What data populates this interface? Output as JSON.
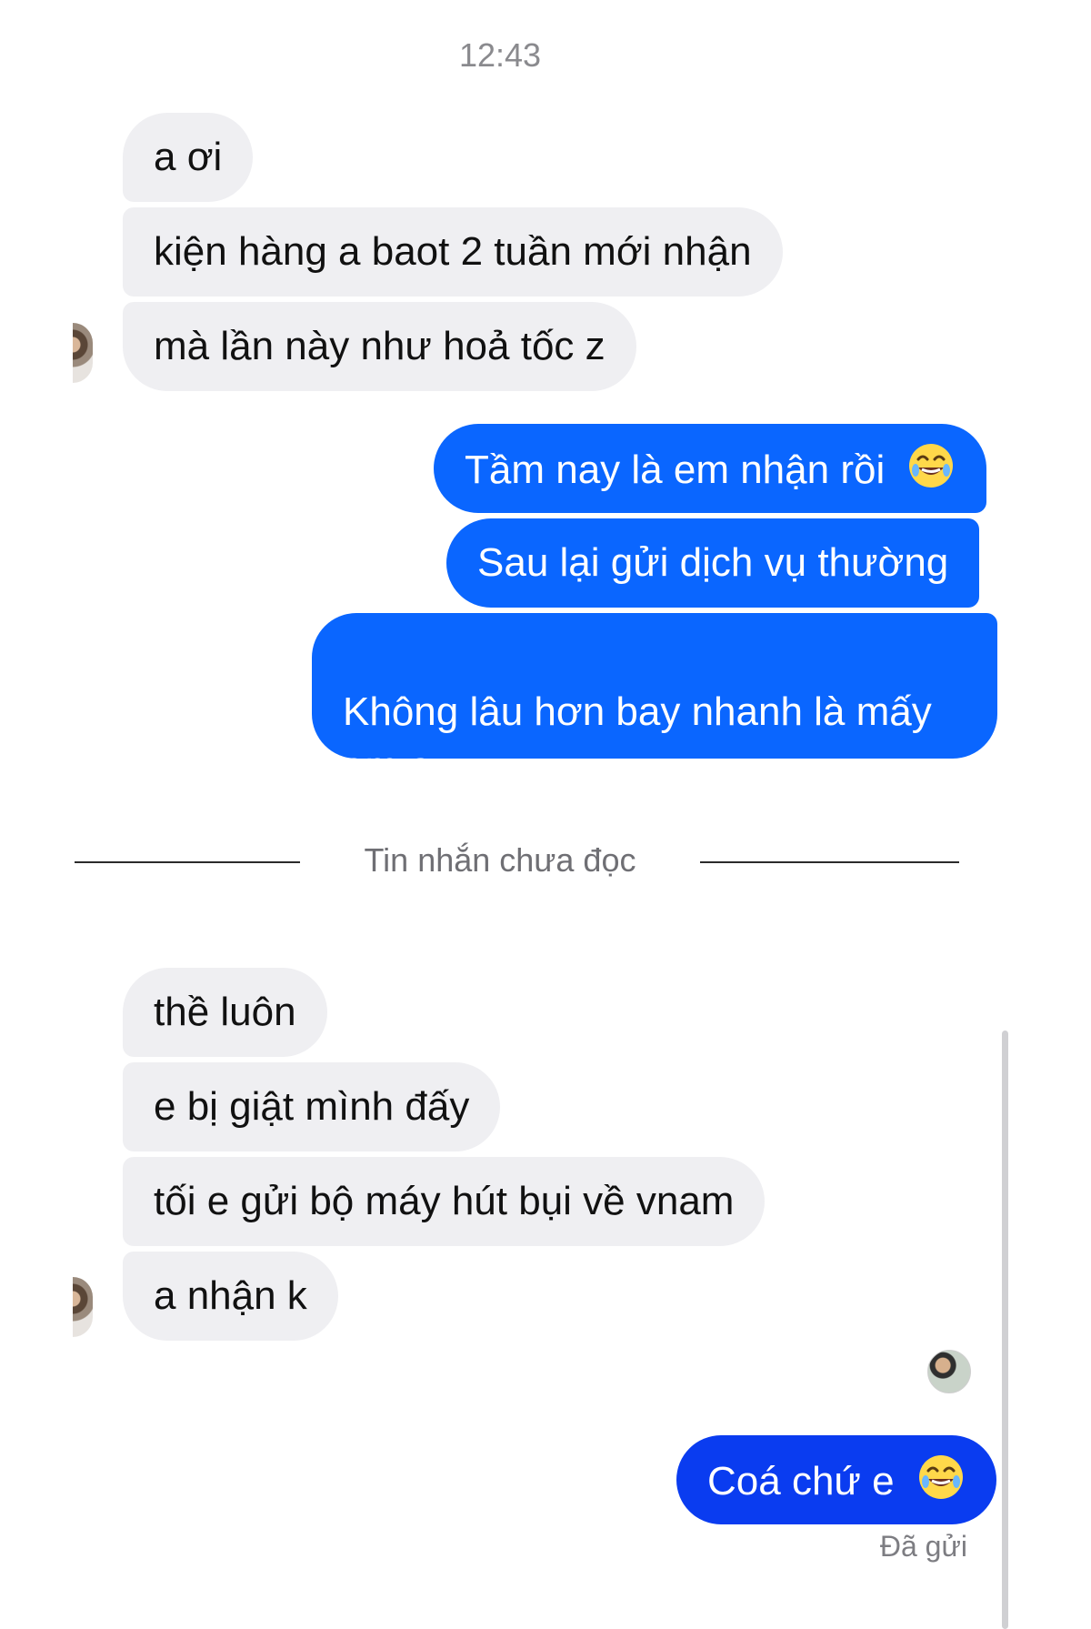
{
  "thread": {
    "timestamp": "12:43",
    "unread_divider": "Tin nhắn chưa đọc",
    "messages": [
      {
        "sender": "them",
        "text": "a ơi"
      },
      {
        "sender": "them",
        "text": "kiện hàng a baot 2 tuần mới nhận"
      },
      {
        "sender": "them",
        "text": "mà lần này như hoả tốc z"
      },
      {
        "sender": "me",
        "text": "Tầm nay là em nhận rồi",
        "emoji": "face-with-tears-of-joy"
      },
      {
        "sender": "me",
        "text": "Sau lại gửi dịch vụ thường"
      },
      {
        "sender": "me",
        "text": "Không lâu hơn bay nhanh là mấy\nem ạ"
      },
      {
        "sender": "them",
        "text": "thề luôn"
      },
      {
        "sender": "them",
        "text": "e bị giật mình đấy"
      },
      {
        "sender": "them",
        "text": "tối e gửi bộ máy hút bụi về vnam"
      },
      {
        "sender": "them",
        "text": "a nhận k"
      },
      {
        "sender": "me",
        "text": "Coá chứ e",
        "emoji": "face-with-tears-of-joy"
      }
    ],
    "delivery_status": "Đã gửi"
  },
  "colors": {
    "incoming_bubble": "#efeff2",
    "outgoing_bubble": "#0a66ff",
    "outgoing_bubble_last": "#0a3cf0",
    "timestamp_text": "#8a8a8e"
  }
}
